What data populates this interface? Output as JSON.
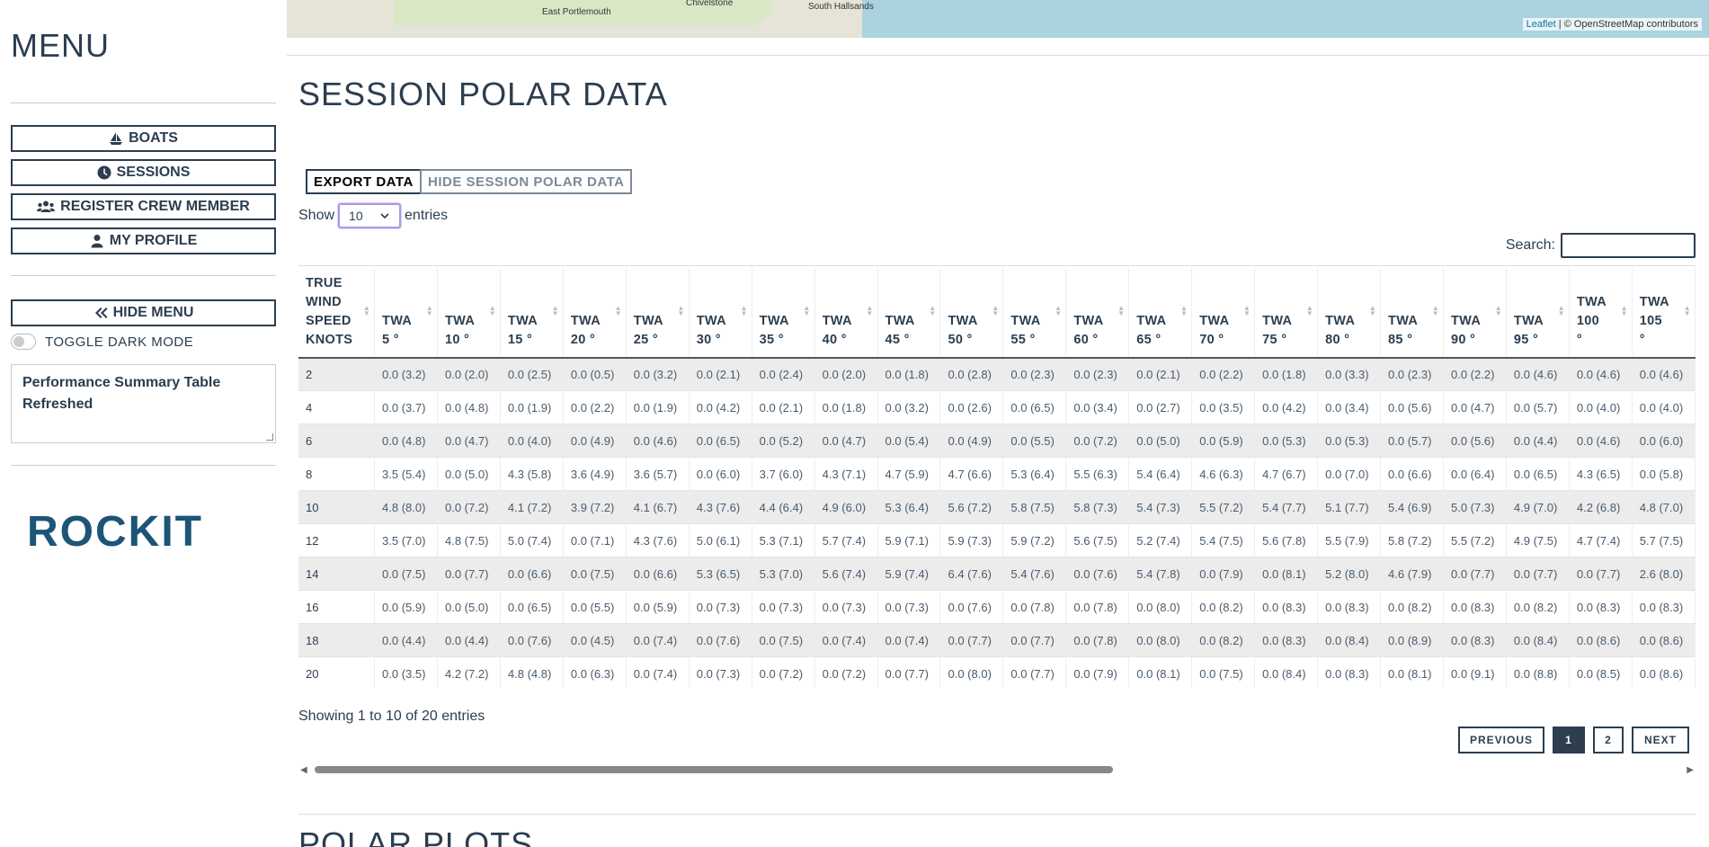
{
  "sidebar": {
    "title": "MENU",
    "buttons": [
      {
        "label": "BOATS",
        "icon": "sailboat-icon"
      },
      {
        "label": "SESSIONS",
        "icon": "clock-icon"
      },
      {
        "label": "REGISTER CREW MEMBER",
        "icon": "users-icon"
      },
      {
        "label": "MY PROFILE",
        "icon": "user-icon"
      }
    ],
    "hide_menu_label": "HIDE MENU",
    "toggle_dark_mode_label": "TOGGLE DARK MODE",
    "notice_text": "Performance Summary Table Refreshed",
    "logo_text": "ROCKIT"
  },
  "map": {
    "labels": [
      "Chivelstone",
      "South Hallsands",
      "East Portlemouth"
    ],
    "attribution_link": "Leaflet",
    "attribution_text": "| © OpenStreetMap contributors"
  },
  "main": {
    "section_title": "SESSION POLAR DATA",
    "export_label": "EXPORT DATA",
    "hide_polar_label": "HIDE SESSION POLAR DATA",
    "show_label": "Show",
    "entries_label": "entries",
    "page_size": "10",
    "search_label": "Search:",
    "info_text": "Showing 1 to 10 of 20 entries",
    "prev_label": "PREVIOUS",
    "next_label": "NEXT",
    "pages": [
      "1",
      "2"
    ],
    "active_page": "1",
    "next_section_title": "POLAR PLOTS"
  },
  "table": {
    "first_header": [
      "TRUE",
      "WIND",
      "SPEED",
      "KNOTS"
    ],
    "headers": [
      [
        "TWA",
        "5 °"
      ],
      [
        "TWA",
        "10 °"
      ],
      [
        "TWA",
        "15 °"
      ],
      [
        "TWA",
        "20 °"
      ],
      [
        "TWA",
        "25 °"
      ],
      [
        "TWA",
        "30 °"
      ],
      [
        "TWA",
        "35 °"
      ],
      [
        "TWA",
        "40 °"
      ],
      [
        "TWA",
        "45 °"
      ],
      [
        "TWA",
        "50 °"
      ],
      [
        "TWA",
        "55 °"
      ],
      [
        "TWA",
        "60 °"
      ],
      [
        "TWA",
        "65 °"
      ],
      [
        "TWA",
        "70 °"
      ],
      [
        "TWA",
        "75 °"
      ],
      [
        "TWA",
        "80 °"
      ],
      [
        "TWA",
        "85 °"
      ],
      [
        "TWA",
        "90 °"
      ],
      [
        "TWA",
        "95 °"
      ],
      [
        "TWA",
        "100",
        "°"
      ],
      [
        "TWA",
        "105",
        "°"
      ]
    ],
    "rows": [
      [
        "2",
        "0.0 (3.2)",
        "0.0 (2.0)",
        "0.0 (2.5)",
        "0.0 (0.5)",
        "0.0 (3.2)",
        "0.0 (2.1)",
        "0.0 (2.4)",
        "0.0 (2.0)",
        "0.0 (1.8)",
        "0.0 (2.8)",
        "0.0 (2.3)",
        "0.0 (2.3)",
        "0.0 (2.1)",
        "0.0 (2.2)",
        "0.0 (1.8)",
        "0.0 (3.3)",
        "0.0 (2.3)",
        "0.0 (2.2)",
        "0.0 (4.6)",
        "0.0 (4.6)",
        "0.0 (4.6)"
      ],
      [
        "4",
        "0.0 (3.7)",
        "0.0 (4.8)",
        "0.0 (1.9)",
        "0.0 (2.2)",
        "0.0 (1.9)",
        "0.0 (4.2)",
        "0.0 (2.1)",
        "0.0 (1.8)",
        "0.0 (3.2)",
        "0.0 (2.6)",
        "0.0 (6.5)",
        "0.0 (3.4)",
        "0.0 (2.7)",
        "0.0 (3.5)",
        "0.0 (4.2)",
        "0.0 (3.4)",
        "0.0 (5.6)",
        "0.0 (4.7)",
        "0.0 (5.7)",
        "0.0 (4.0)",
        "0.0 (4.0)"
      ],
      [
        "6",
        "0.0 (4.8)",
        "0.0 (4.7)",
        "0.0 (4.0)",
        "0.0 (4.9)",
        "0.0 (4.6)",
        "0.0 (6.5)",
        "0.0 (5.2)",
        "0.0 (4.7)",
        "0.0 (5.4)",
        "0.0 (4.9)",
        "0.0 (5.5)",
        "0.0 (7.2)",
        "0.0 (5.0)",
        "0.0 (5.9)",
        "0.0 (5.3)",
        "0.0 (5.3)",
        "0.0 (5.7)",
        "0.0 (5.6)",
        "0.0 (4.4)",
        "0.0 (4.6)",
        "0.0 (6.0)"
      ],
      [
        "8",
        "3.5 (5.4)",
        "0.0 (5.0)",
        "4.3 (5.8)",
        "3.6 (4.9)",
        "3.6 (5.7)",
        "0.0 (6.0)",
        "3.7 (6.0)",
        "4.3 (7.1)",
        "4.7 (5.9)",
        "4.7 (6.6)",
        "5.3 (6.4)",
        "5.5 (6.3)",
        "5.4 (6.4)",
        "4.6 (6.3)",
        "4.7 (6.7)",
        "0.0 (7.0)",
        "0.0 (6.6)",
        "0.0 (6.4)",
        "0.0 (6.5)",
        "4.3 (6.5)",
        "0.0 (5.8)"
      ],
      [
        "10",
        "4.8 (8.0)",
        "0.0 (7.2)",
        "4.1 (7.2)",
        "3.9 (7.2)",
        "4.1 (6.7)",
        "4.3 (7.6)",
        "4.4 (6.4)",
        "4.9 (6.0)",
        "5.3 (6.4)",
        "5.6 (7.2)",
        "5.8 (7.5)",
        "5.8 (7.3)",
        "5.4 (7.3)",
        "5.5 (7.2)",
        "5.4 (7.7)",
        "5.1 (7.7)",
        "5.4 (6.9)",
        "5.0 (7.3)",
        "4.9 (7.0)",
        "4.2 (6.8)",
        "4.8 (7.0)"
      ],
      [
        "12",
        "3.5 (7.0)",
        "4.8 (7.5)",
        "5.0 (7.4)",
        "0.0 (7.1)",
        "4.3 (7.6)",
        "5.0 (6.1)",
        "5.3 (7.1)",
        "5.7 (7.4)",
        "5.9 (7.1)",
        "5.9 (7.3)",
        "5.9 (7.2)",
        "5.6 (7.5)",
        "5.2 (7.4)",
        "5.4 (7.5)",
        "5.6 (7.8)",
        "5.5 (7.9)",
        "5.8 (7.2)",
        "5.5 (7.2)",
        "4.9 (7.5)",
        "4.7 (7.4)",
        "5.7 (7.5)"
      ],
      [
        "14",
        "0.0 (7.5)",
        "0.0 (7.7)",
        "0.0 (6.6)",
        "0.0 (7.5)",
        "0.0 (6.6)",
        "5.3 (6.5)",
        "5.3 (7.0)",
        "5.6 (7.4)",
        "5.9 (7.4)",
        "6.4 (7.6)",
        "5.4 (7.6)",
        "0.0 (7.6)",
        "5.4 (7.8)",
        "0.0 (7.9)",
        "0.0 (8.1)",
        "5.2 (8.0)",
        "4.6 (7.9)",
        "0.0 (7.7)",
        "0.0 (7.7)",
        "0.0 (7.7)",
        "2.6 (8.0)"
      ],
      [
        "16",
        "0.0 (5.9)",
        "0.0 (5.0)",
        "0.0 (6.5)",
        "0.0 (5.5)",
        "0.0 (5.9)",
        "0.0 (7.3)",
        "0.0 (7.3)",
        "0.0 (7.3)",
        "0.0 (7.3)",
        "0.0 (7.6)",
        "0.0 (7.8)",
        "0.0 (7.8)",
        "0.0 (8.0)",
        "0.0 (8.2)",
        "0.0 (8.3)",
        "0.0 (8.3)",
        "0.0 (8.2)",
        "0.0 (8.3)",
        "0.0 (8.2)",
        "0.0 (8.3)",
        "0.0 (8.3)"
      ],
      [
        "18",
        "0.0 (4.4)",
        "0.0 (4.4)",
        "0.0 (7.6)",
        "0.0 (4.5)",
        "0.0 (7.4)",
        "0.0 (7.6)",
        "0.0 (7.5)",
        "0.0 (7.4)",
        "0.0 (7.4)",
        "0.0 (7.7)",
        "0.0 (7.7)",
        "0.0 (7.8)",
        "0.0 (8.0)",
        "0.0 (8.2)",
        "0.0 (8.3)",
        "0.0 (8.4)",
        "0.0 (8.9)",
        "0.0 (8.3)",
        "0.0 (8.4)",
        "0.0 (8.6)",
        "0.0 (8.6)"
      ],
      [
        "20",
        "0.0 (3.5)",
        "4.2 (7.2)",
        "4.8 (4.8)",
        "0.0 (6.3)",
        "0.0 (7.4)",
        "0.0 (7.3)",
        "0.0 (7.2)",
        "0.0 (7.2)",
        "0.0 (7.7)",
        "0.0 (8.0)",
        "0.0 (7.7)",
        "0.0 (7.9)",
        "0.0 (8.1)",
        "0.0 (7.5)",
        "0.0 (8.4)",
        "0.0 (8.3)",
        "0.0 (8.1)",
        "0.0 (9.1)",
        "0.0 (8.8)",
        "0.0 (8.5)",
        "0.0 (8.6)"
      ]
    ]
  },
  "colors": {
    "primary": "#2c3e50",
    "logo": "#1d5577",
    "map_water": "#aad3df",
    "select_focus": "#a999e8"
  }
}
